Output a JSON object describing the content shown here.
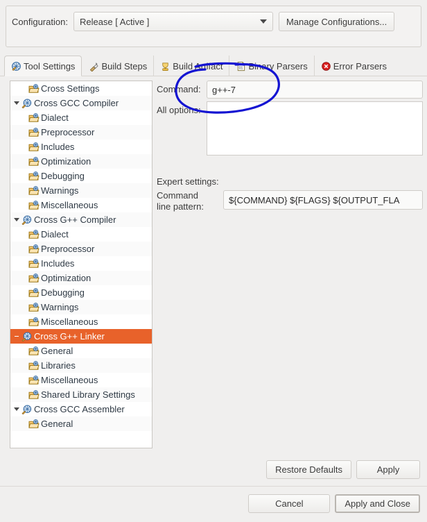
{
  "config": {
    "label": "Configuration:",
    "selected": "Release  [ Active ]",
    "manage_button": "Manage Configurations...",
    "dropdown_icon": "chevron-down-icon"
  },
  "tabs": [
    {
      "label": "Tool Settings",
      "icon": "tool-settings-icon",
      "active": true
    },
    {
      "label": "Build Steps",
      "icon": "build-steps-icon",
      "active": false
    },
    {
      "label": "Build Artifact",
      "icon": "build-artifact-icon",
      "active": false
    },
    {
      "label": "Binary Parsers",
      "icon": "binary-parsers-icon",
      "active": false
    },
    {
      "label": "Error Parsers",
      "icon": "error-parsers-icon",
      "active": false
    }
  ],
  "tree": [
    {
      "label": "Cross Settings",
      "level": 1,
      "icon": "folder-settings-icon",
      "twisty": "none",
      "selected": false
    },
    {
      "label": "Cross GCC Compiler",
      "level": 0,
      "icon": "tool-globe-icon",
      "twisty": "open",
      "selected": false
    },
    {
      "label": "Dialect",
      "level": 1,
      "icon": "folder-settings-icon",
      "twisty": "none",
      "selected": false
    },
    {
      "label": "Preprocessor",
      "level": 1,
      "icon": "folder-settings-icon",
      "twisty": "none",
      "selected": false
    },
    {
      "label": "Includes",
      "level": 1,
      "icon": "folder-settings-icon",
      "twisty": "none",
      "selected": false
    },
    {
      "label": "Optimization",
      "level": 1,
      "icon": "folder-settings-icon",
      "twisty": "none",
      "selected": false
    },
    {
      "label": "Debugging",
      "level": 1,
      "icon": "folder-settings-icon",
      "twisty": "none",
      "selected": false
    },
    {
      "label": "Warnings",
      "level": 1,
      "icon": "folder-settings-icon",
      "twisty": "none",
      "selected": false
    },
    {
      "label": "Miscellaneous",
      "level": 1,
      "icon": "folder-settings-icon",
      "twisty": "none",
      "selected": false
    },
    {
      "label": "Cross G++ Compiler",
      "level": 0,
      "icon": "tool-globe-icon",
      "twisty": "open",
      "selected": false
    },
    {
      "label": "Dialect",
      "level": 1,
      "icon": "folder-settings-icon",
      "twisty": "none",
      "selected": false
    },
    {
      "label": "Preprocessor",
      "level": 1,
      "icon": "folder-settings-icon",
      "twisty": "none",
      "selected": false
    },
    {
      "label": "Includes",
      "level": 1,
      "icon": "folder-settings-icon",
      "twisty": "none",
      "selected": false
    },
    {
      "label": "Optimization",
      "level": 1,
      "icon": "folder-settings-icon",
      "twisty": "none",
      "selected": false
    },
    {
      "label": "Debugging",
      "level": 1,
      "icon": "folder-settings-icon",
      "twisty": "none",
      "selected": false
    },
    {
      "label": "Warnings",
      "level": 1,
      "icon": "folder-settings-icon",
      "twisty": "none",
      "selected": false
    },
    {
      "label": "Miscellaneous",
      "level": 1,
      "icon": "folder-settings-icon",
      "twisty": "none",
      "selected": false
    },
    {
      "label": "Cross G++ Linker",
      "level": 0,
      "icon": "tool-globe-icon",
      "twisty": "selected-open",
      "selected": true
    },
    {
      "label": "General",
      "level": 1,
      "icon": "folder-settings-icon",
      "twisty": "none",
      "selected": false
    },
    {
      "label": "Libraries",
      "level": 1,
      "icon": "folder-settings-icon",
      "twisty": "none",
      "selected": false
    },
    {
      "label": "Miscellaneous",
      "level": 1,
      "icon": "folder-settings-icon",
      "twisty": "none",
      "selected": false
    },
    {
      "label": "Shared Library Settings",
      "level": 1,
      "icon": "folder-settings-icon",
      "twisty": "none",
      "selected": false
    },
    {
      "label": "Cross GCC Assembler",
      "level": 0,
      "icon": "tool-globe-icon",
      "twisty": "open",
      "selected": false
    },
    {
      "label": "General",
      "level": 1,
      "icon": "folder-settings-icon",
      "twisty": "none",
      "selected": false
    }
  ],
  "settings": {
    "command_label": "Command:",
    "command_value": "g++-7",
    "all_options_label": "All options:",
    "all_options_value": "",
    "expert_label": "Expert settings:",
    "pattern_label": "Command\nline pattern:",
    "pattern_label_line1": "Command",
    "pattern_label_line2": "line pattern:",
    "pattern_value": "${COMMAND} ${FLAGS} ${OUTPUT_FLA"
  },
  "buttons": {
    "restore_defaults": "Restore Defaults",
    "apply": "Apply",
    "cancel": "Cancel",
    "apply_and_close": "Apply and Close"
  },
  "annotation": {
    "type": "hand-drawn-ellipse",
    "color": "#1414d2",
    "target": "command-field"
  },
  "colors": {
    "selection": "#e8622a",
    "background": "#f0efee",
    "annotation": "#1414d2"
  }
}
